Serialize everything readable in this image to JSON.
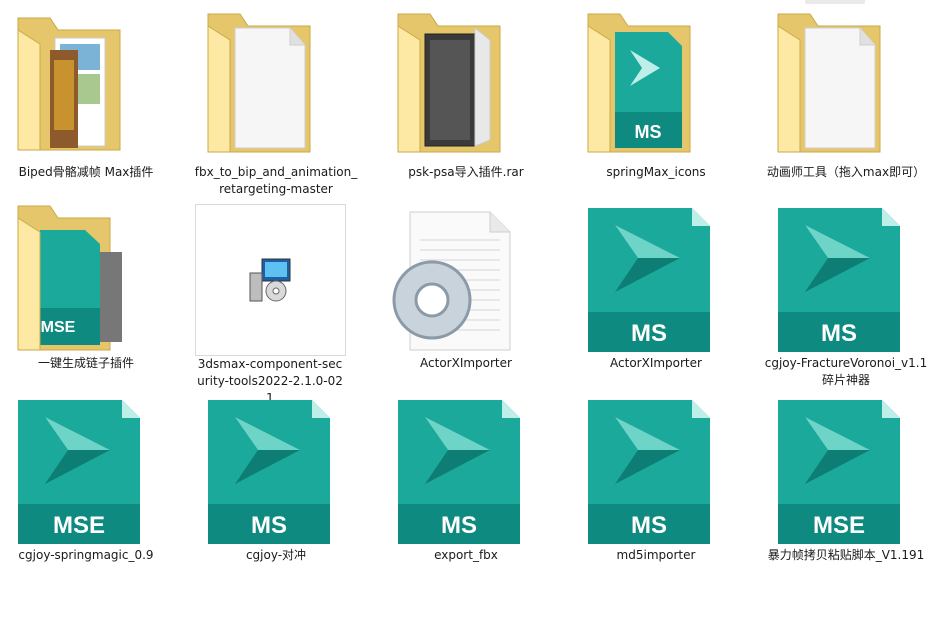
{
  "colors": {
    "folder_back": "#e6c66a",
    "folder_front": "#fde9a3",
    "folder_stroke": "#c9a94a",
    "max_teal": "#1aa99b",
    "max_teal_dark": "#0e7d73",
    "max_band": "#0f8a80"
  },
  "items": [
    {
      "label": "Biped骨骼减帧 Max插件",
      "icon": "folder-with-images-icon"
    },
    {
      "label": "fbx_to_bip_and_animation_retargeting-master",
      "icon": "folder-with-documents-icon"
    },
    {
      "label": "psk-psa导入插件.rar",
      "icon": "folder-with-archive-icon"
    },
    {
      "label": "springMax_icons",
      "icon": "folder-with-ms-icon"
    },
    {
      "label": "动画师工具（拖入max即可）",
      "icon": "folder-with-documents-icon"
    },
    {
      "label": "一键生成链子插件",
      "icon": "folder-with-mse-icon"
    },
    {
      "label": "3dsmax-component-security-tools2022-2.1.0-021",
      "icon": "installer-icon"
    },
    {
      "label": "ActorXImporter",
      "icon": "gear-document-icon"
    },
    {
      "label": "ActorXImporter",
      "icon": "maxscript-ms-icon",
      "badge": "MS"
    },
    {
      "label": "cgjoy-FractureVoronoi_v1.1碎片神器",
      "icon": "maxscript-ms-icon",
      "badge": "MS"
    },
    {
      "label": "cgjoy-springmagic_0.9",
      "icon": "maxscript-mse-icon",
      "badge": "MSE"
    },
    {
      "label": "cgjoy-对冲",
      "icon": "maxscript-ms-icon",
      "badge": "MS"
    },
    {
      "label": "export_fbx",
      "icon": "maxscript-ms-icon",
      "badge": "MS"
    },
    {
      "label": "md5importer",
      "icon": "maxscript-ms-icon",
      "badge": "MS"
    },
    {
      "label": "暴力帧拷贝粘贴脚本_V1.191",
      "icon": "maxscript-mse-icon",
      "badge": "MSE"
    }
  ],
  "badges": {
    "ms": "MS",
    "mse": "MSE"
  }
}
